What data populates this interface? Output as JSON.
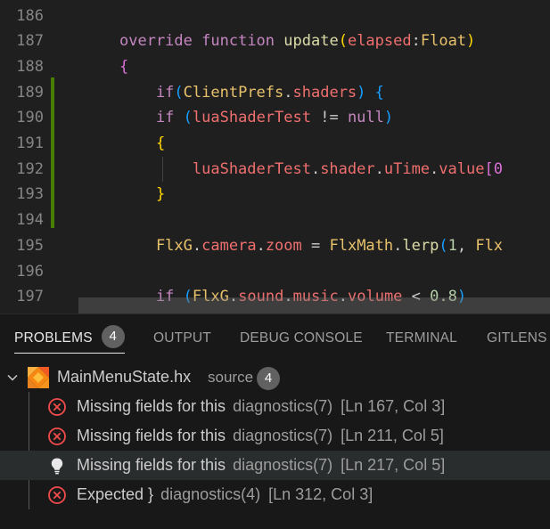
{
  "editor": {
    "line_numbers": [
      "186",
      "187",
      "188",
      "189",
      "190",
      "191",
      "192",
      "193",
      "194",
      "195",
      "196",
      "197"
    ],
    "lines": [
      [],
      [
        {
          "t": "override",
          "c": "kw"
        },
        {
          "t": " ",
          "c": "op"
        },
        {
          "t": "function",
          "c": "kw"
        },
        {
          "t": " ",
          "c": "op"
        },
        {
          "t": "update",
          "c": "fn"
        },
        {
          "t": "(",
          "c": "br1"
        },
        {
          "t": "elapsed",
          "c": "pr"
        },
        {
          "t": ":",
          "c": "op"
        },
        {
          "t": "Float",
          "c": "ty"
        },
        {
          "t": ")",
          "c": "br1"
        }
      ],
      [
        {
          "t": "{",
          "c": "br2"
        }
      ],
      [
        {
          "t": "    if",
          "c": "kw"
        },
        {
          "t": "(",
          "c": "br3"
        },
        {
          "t": "ClientPrefs",
          "c": "cls"
        },
        {
          "t": ".",
          "c": "op"
        },
        {
          "t": "shaders",
          "c": "id"
        },
        {
          "t": ")",
          "c": "br3"
        },
        {
          "t": " ",
          "c": "op"
        },
        {
          "t": "{",
          "c": "br3"
        }
      ],
      [
        {
          "t": "    if",
          "c": "kw"
        },
        {
          "t": " ",
          "c": "op"
        },
        {
          "t": "(",
          "c": "br3"
        },
        {
          "t": "luaShaderTest",
          "c": "id"
        },
        {
          "t": " != ",
          "c": "op"
        },
        {
          "t": "null",
          "c": "kw"
        },
        {
          "t": ")",
          "c": "br3"
        }
      ],
      [
        {
          "t": "    {",
          "c": "br1"
        }
      ],
      [
        {
          "t": "        luaShaderTest",
          "c": "id"
        },
        {
          "t": ".",
          "c": "op"
        },
        {
          "t": "shader",
          "c": "id"
        },
        {
          "t": ".",
          "c": "op"
        },
        {
          "t": "uTime",
          "c": "id"
        },
        {
          "t": ".",
          "c": "op"
        },
        {
          "t": "value",
          "c": "id"
        },
        {
          "t": "[0",
          "c": "br2"
        }
      ],
      [
        {
          "t": "    }",
          "c": "br1"
        }
      ],
      [],
      [
        {
          "t": "    FlxG",
          "c": "cls"
        },
        {
          "t": ".",
          "c": "op"
        },
        {
          "t": "camera",
          "c": "id"
        },
        {
          "t": ".",
          "c": "op"
        },
        {
          "t": "zoom",
          "c": "id"
        },
        {
          "t": " = ",
          "c": "op"
        },
        {
          "t": "FlxMath",
          "c": "cls"
        },
        {
          "t": ".",
          "c": "op"
        },
        {
          "t": "lerp",
          "c": "fn"
        },
        {
          "t": "(",
          "c": "br3"
        },
        {
          "t": "1",
          "c": "nm"
        },
        {
          "t": ", ",
          "c": "op"
        },
        {
          "t": "Flx",
          "c": "cls"
        }
      ],
      [],
      [
        {
          "t": "    if",
          "c": "kw"
        },
        {
          "t": " ",
          "c": "op"
        },
        {
          "t": "(",
          "c": "br3"
        },
        {
          "t": "FlxG",
          "c": "cls"
        },
        {
          "t": ".",
          "c": "op"
        },
        {
          "t": "sound",
          "c": "id"
        },
        {
          "t": ".",
          "c": "op"
        },
        {
          "t": "music",
          "c": "id"
        },
        {
          "t": ".",
          "c": "op"
        },
        {
          "t": "volume",
          "c": "id"
        },
        {
          "t": " < ",
          "c": "op"
        },
        {
          "t": "0.8",
          "c": "nm"
        },
        {
          "t": ")",
          "c": "br3"
        }
      ]
    ]
  },
  "panel": {
    "tabs": [
      {
        "label": "PROBLEMS",
        "badge": "4",
        "active": true
      },
      {
        "label": "OUTPUT"
      },
      {
        "label": "DEBUG CONSOLE"
      },
      {
        "label": "TERMINAL"
      },
      {
        "label": "GITLENS"
      }
    ],
    "file": {
      "name": "MainMenuState.hx",
      "source": "source",
      "count": "4"
    },
    "problems": [
      {
        "icon": "error-icon",
        "message": "Missing fields for this",
        "source": "diagnostics(7)",
        "location": "[Ln 167, Col 3]"
      },
      {
        "icon": "error-icon",
        "message": "Missing fields for this",
        "source": "diagnostics(7)",
        "location": "[Ln 211, Col 5]"
      },
      {
        "icon": "lightbulb-icon",
        "message": "Missing fields for this",
        "source": "diagnostics(7)",
        "location": "[Ln 217, Col 5]",
        "selected": true
      },
      {
        "icon": "error-icon",
        "message": "Expected }",
        "source": "diagnostics(4)",
        "location": "[Ln 312, Col 3]"
      }
    ]
  },
  "colors": {
    "accent_modified": "#487e02",
    "error": "#f14c4c",
    "haxe_logo": "#f68712"
  }
}
